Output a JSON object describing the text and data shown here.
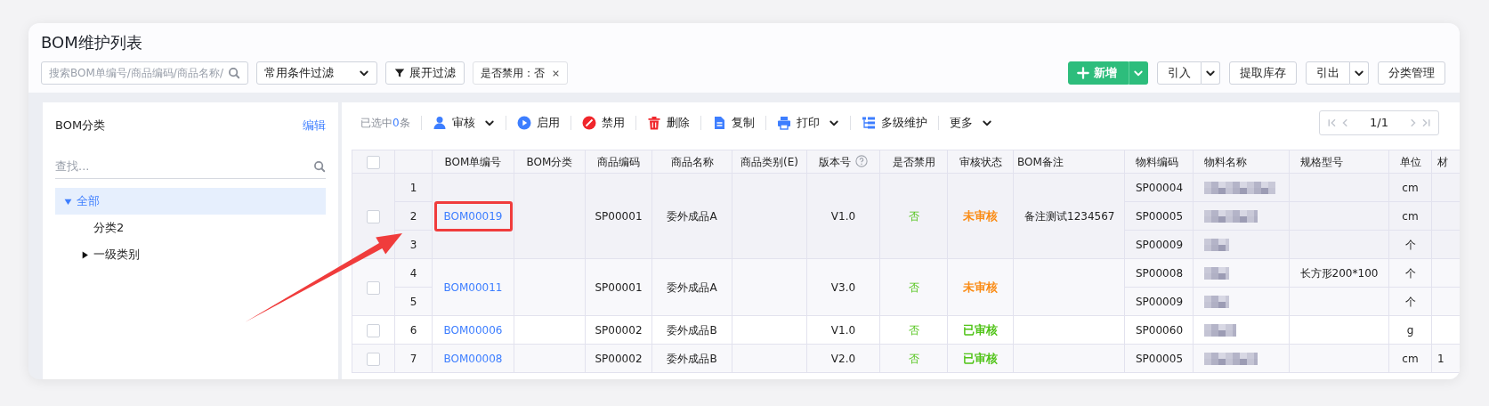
{
  "page_title": "BOM维护列表",
  "filter_bar": {
    "search": {
      "placeholder": "搜索BOM单编号/商品编码/商品名称/"
    },
    "condition_select": "常用条件过滤",
    "expand_filter": "展开过滤",
    "tags": [
      {
        "label": "是否禁用：否"
      }
    ]
  },
  "actions": [
    {
      "label": "新增",
      "kind": "primary",
      "split": true
    },
    {
      "label": "引入",
      "kind": "default",
      "split": true
    },
    {
      "label": "提取库存",
      "kind": "default",
      "split": false
    },
    {
      "label": "引出",
      "kind": "default",
      "split": true
    },
    {
      "label": "分类管理",
      "kind": "default",
      "split": false
    }
  ],
  "sidebar": {
    "title": "BOM分类",
    "edit_link": "编辑",
    "search": {
      "placeholder": "查找..."
    },
    "tree": [
      {
        "label": "全部",
        "expanded": true,
        "selected": true,
        "children": [
          {
            "label": "分类2",
            "selected": false
          },
          {
            "label": "一级类别",
            "expanded": false,
            "selected": false
          }
        ]
      }
    ]
  },
  "toolbar": {
    "selection": {
      "prefix": "已选中",
      "count": "0",
      "suffix": "条"
    },
    "buttons": [
      {
        "label": "审核",
        "dropdown": true
      },
      {
        "label": "启用",
        "dropdown": false
      },
      {
        "label": "禁用",
        "dropdown": false
      },
      {
        "label": "删除",
        "dropdown": false
      },
      {
        "label": "复制",
        "dropdown": false
      },
      {
        "label": "打印",
        "dropdown": true
      },
      {
        "label": "多级维护",
        "dropdown": false
      },
      {
        "label": "更多",
        "dropdown": true
      }
    ],
    "pagination": {
      "page": "1/1"
    }
  },
  "table": {
    "select_all": {
      "checked": false
    },
    "columns": [
      {
        "label": "BOM单编号"
      },
      {
        "label": "BOM分类"
      },
      {
        "label": "商品编码"
      },
      {
        "label": "商品名称"
      },
      {
        "label": "商品类别(E)"
      },
      {
        "label": "版本号",
        "help": true
      },
      {
        "label": "是否禁用"
      },
      {
        "label": "审核状态"
      },
      {
        "label": "BOM备注"
      },
      {
        "label": "物料编码"
      },
      {
        "label": "物料名称"
      },
      {
        "label": "规格型号"
      },
      {
        "label": "单位"
      },
      {
        "label": "材"
      }
    ],
    "rows": [
      {
        "checked": false,
        "hovered": true,
        "highlighted": true,
        "bom_no": "BOM00019",
        "product_code": "SP00001",
        "product_name": "委外成品A",
        "version": "V1.0",
        "disabled_text": "否",
        "review_status": {
          "text": "未审核",
          "color": "#fa8c16"
        },
        "remark": "备注测试1234567",
        "lines": [
          {
            "index": "1",
            "material_code": "SP00004",
            "name_blurred": true,
            "unit": "cm"
          },
          {
            "index": "2",
            "material_code": "SP00005",
            "name_blurred": true,
            "unit": "cm"
          },
          {
            "index": "3",
            "material_code": "SP00009",
            "name_blurred": true,
            "unit": "个"
          }
        ]
      },
      {
        "checked": false,
        "hovered": false,
        "highlighted": false,
        "bom_no": "BOM00011",
        "product_code": "SP00001",
        "product_name": "委外成品A",
        "version": "V3.0",
        "disabled_text": "否",
        "review_status": {
          "text": "未审核",
          "color": "#fa8c16"
        },
        "lines": [
          {
            "index": "4",
            "material_code": "SP00008",
            "name_blurred": true,
            "spec": "长方形200*100",
            "unit": "个"
          },
          {
            "index": "5",
            "material_code": "SP00009",
            "name_blurred": true,
            "unit": "个"
          }
        ]
      },
      {
        "checked": false,
        "hovered": false,
        "highlighted": false,
        "bom_no": "BOM00006",
        "product_code": "SP00002",
        "product_name": "委外成品B",
        "version": "V1.0",
        "disabled_text": "否",
        "review_status": {
          "text": "已审核",
          "color": "#52c41a"
        },
        "lines": [
          {
            "index": "6",
            "material_code": "SP00060",
            "name_blurred": true,
            "unit": "g"
          }
        ]
      },
      {
        "checked": false,
        "hovered": false,
        "highlighted": false,
        "bom_no": "BOM00008",
        "product_code": "SP00002",
        "product_name": "委外成品B",
        "version": "V2.0",
        "disabled_text": "否",
        "review_status": {
          "text": "已审核",
          "color": "#52c41a"
        },
        "lines": [
          {
            "index": "7",
            "material_code": "SP00005",
            "name_blurred": true,
            "unit": "cm",
            "column_15": "1"
          }
        ]
      }
    ]
  }
}
